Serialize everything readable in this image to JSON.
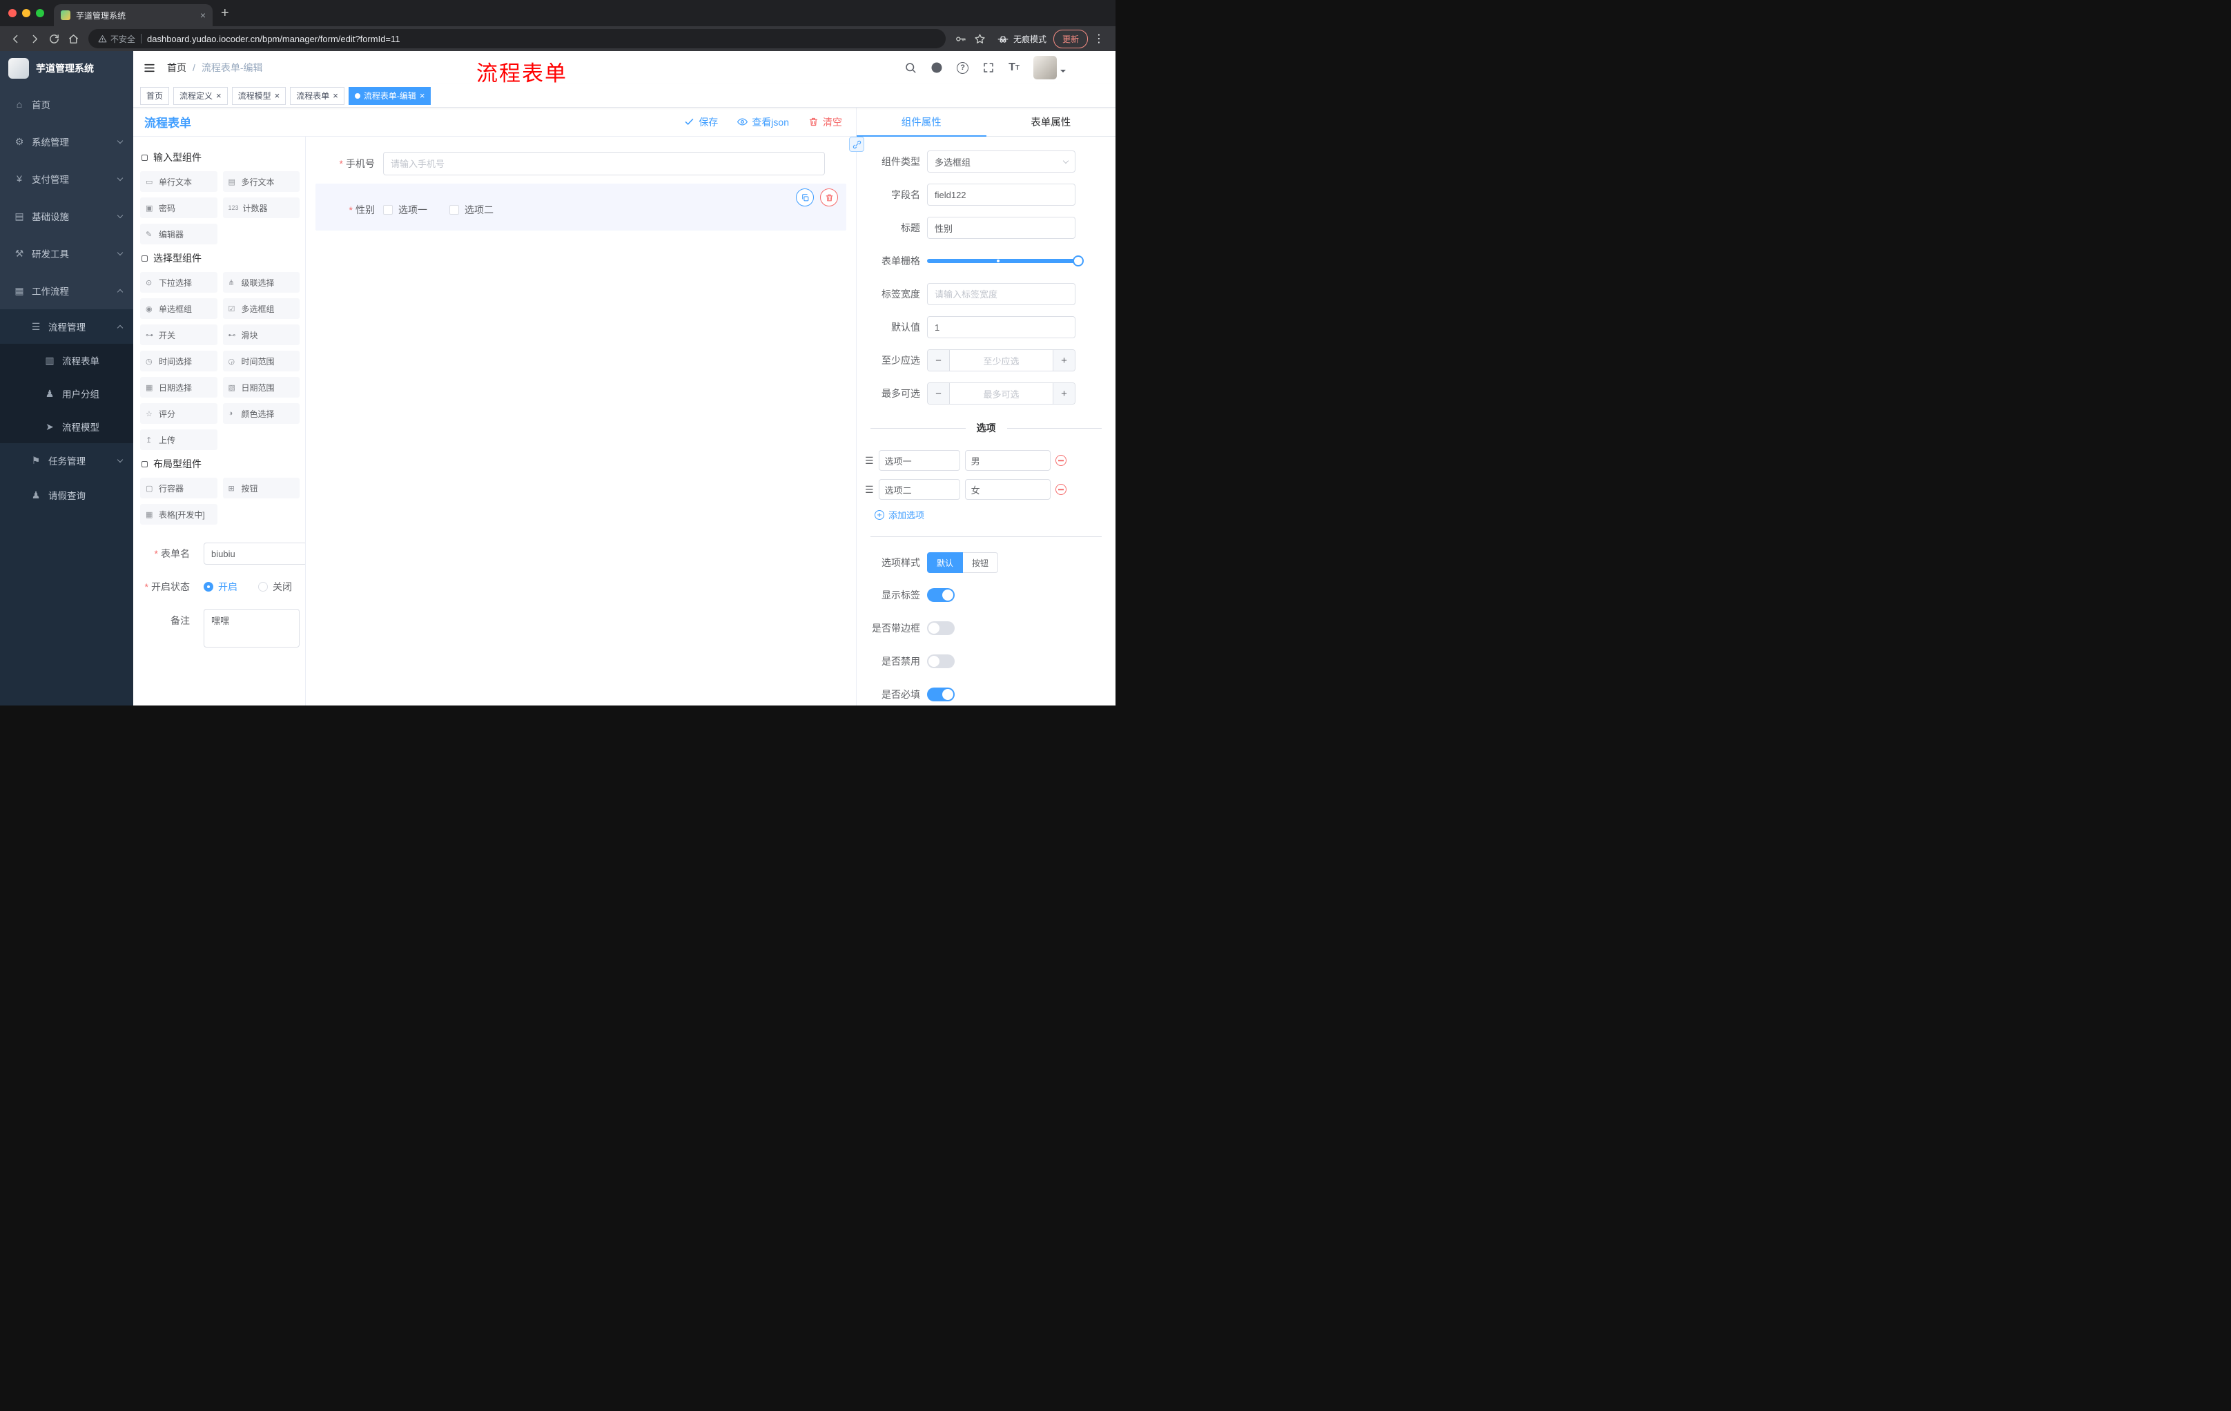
{
  "browser": {
    "tab_title": "芋道管理系统",
    "security": "不安全",
    "url": "dashboard.yudao.iocoder.cn/bpm/manager/form/edit?formId=11",
    "incognito": "无痕模式",
    "update": "更新"
  },
  "sidebar": {
    "title": "芋道管理系统",
    "items": [
      {
        "icon": "⌂",
        "label": "首页"
      },
      {
        "icon": "⚙",
        "label": "系统管理"
      },
      {
        "icon": "¥",
        "label": "支付管理"
      },
      {
        "icon": "▤",
        "label": "基础设施"
      },
      {
        "icon": "⚒",
        "label": "研发工具"
      },
      {
        "icon": "▦",
        "label": "工作流程"
      },
      {
        "icon": "☰",
        "label": "流程管理"
      },
      {
        "icon": "▥",
        "label": "流程表单"
      },
      {
        "icon": "♟",
        "label": "用户分组"
      },
      {
        "icon": "➤",
        "label": "流程模型"
      },
      {
        "icon": "⚑",
        "label": "任务管理"
      },
      {
        "icon": "♟",
        "label": "请假查询"
      }
    ]
  },
  "header": {
    "breadcrumb": [
      "首页",
      "流程表单-编辑"
    ],
    "overlay": "流程表单"
  },
  "tags": [
    {
      "label": "首页"
    },
    {
      "label": "流程定义"
    },
    {
      "label": "流程模型"
    },
    {
      "label": "流程表单"
    },
    {
      "label": "流程表单-编辑"
    }
  ],
  "designer": {
    "title": "流程表单",
    "actions": {
      "save": "保存",
      "view_json": "查看json",
      "clear": "清空"
    },
    "groups": [
      {
        "title": "输入型组件",
        "items": [
          {
            "icon": "▭",
            "label": "单行文本"
          },
          {
            "icon": "▤",
            "label": "多行文本"
          },
          {
            "icon": "▣",
            "label": "密码"
          },
          {
            "icon": "123",
            "label": "计数器"
          },
          {
            "icon": "✎",
            "label": "编辑器"
          }
        ]
      },
      {
        "title": "选择型组件",
        "items": [
          {
            "icon": "⊙",
            "label": "下拉选择"
          },
          {
            "icon": "⋔",
            "label": "级联选择"
          },
          {
            "icon": "◉",
            "label": "单选框组"
          },
          {
            "icon": "☑",
            "label": "多选框组"
          },
          {
            "icon": "⊶",
            "label": "开关"
          },
          {
            "icon": "⊷",
            "label": "滑块"
          },
          {
            "icon": "◷",
            "label": "时间选择"
          },
          {
            "icon": "◶",
            "label": "时间范围"
          },
          {
            "icon": "▦",
            "label": "日期选择"
          },
          {
            "icon": "▧",
            "label": "日期范围"
          },
          {
            "icon": "☆",
            "label": "评分"
          },
          {
            "icon": "◑",
            "label": "颜色选择"
          },
          {
            "icon": "↥",
            "label": "上传"
          }
        ]
      },
      {
        "title": "布局型组件",
        "items": [
          {
            "icon": "▢",
            "label": "行容器"
          },
          {
            "icon": "⊞",
            "label": "按钮"
          },
          {
            "icon": "▦",
            "label": "表格[开发中]"
          }
        ]
      }
    ],
    "meta": {
      "name_label": "表单名",
      "name_value": "biubiu",
      "status_label": "开启状态",
      "status_on": "开启",
      "status_off": "关闭",
      "remark_label": "备注",
      "remark_value": "嘿嘿"
    },
    "canvas": {
      "phone_label": "手机号",
      "phone_placeholder": "请输入手机号",
      "gender_label": "性别",
      "gender_options": [
        "选项一",
        "选项二"
      ]
    }
  },
  "props": {
    "tabs": [
      "组件属性",
      "表单属性"
    ],
    "component_type_label": "组件类型",
    "component_type_value": "多选框组",
    "field_label": "字段名",
    "field_value": "field122",
    "title_label": "标题",
    "title_value": "性别",
    "grid_label": "表单栅格",
    "width_label": "标签宽度",
    "width_placeholder": "请输入标签宽度",
    "default_label": "默认值",
    "default_value": "1",
    "min_label": "至少应选",
    "min_placeholder": "至少应选",
    "max_label": "最多可选",
    "max_placeholder": "最多可选",
    "options_title": "选项",
    "options": [
      {
        "name": "选项一",
        "value": "男"
      },
      {
        "name": "选项二",
        "value": "女"
      }
    ],
    "add_option": "添加选项",
    "style_label": "选项样式",
    "style_options": [
      "默认",
      "按钮"
    ],
    "toggles": [
      {
        "label": "显示标签",
        "on": true
      },
      {
        "label": "是否带边框",
        "on": false
      },
      {
        "label": "是否禁用",
        "on": false
      },
      {
        "label": "是否必填",
        "on": true
      }
    ],
    "colors": {
      "primary": "#409eff",
      "danger": "#f56c6c",
      "annotation": "#ff0000"
    }
  }
}
